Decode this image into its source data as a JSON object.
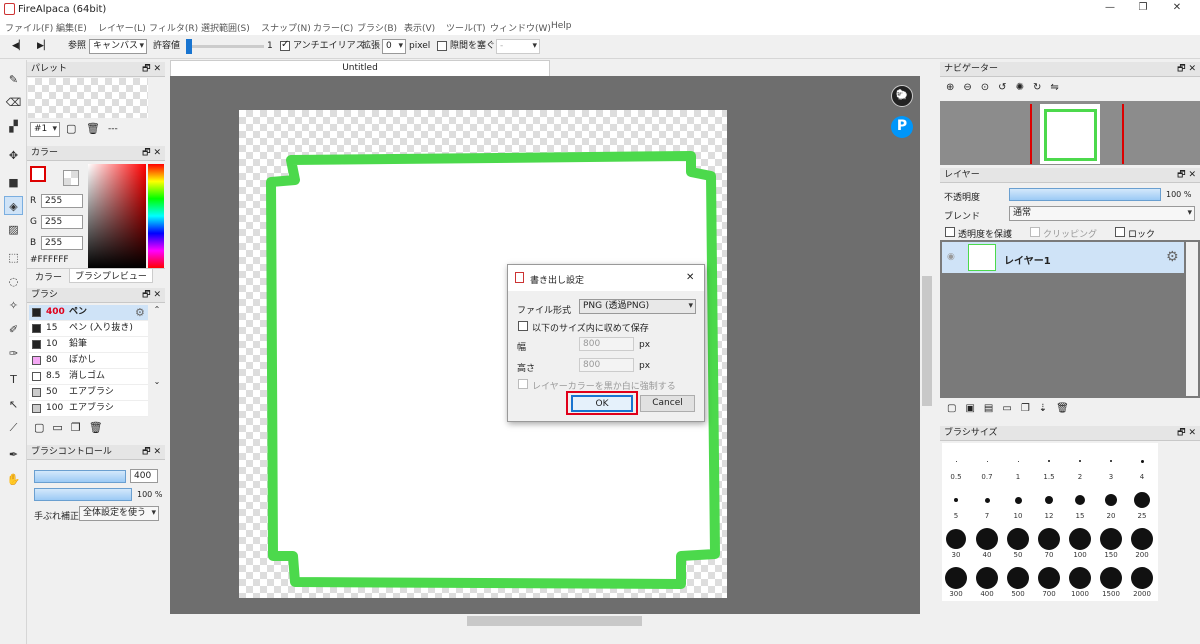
{
  "window": {
    "title": "FireAlpaca (64bit)",
    "min": "—",
    "max": "❐",
    "close": "✕"
  },
  "menu": [
    "ファイル(F)",
    "編集(E)",
    "レイヤー(L)",
    "フィルタ(R)",
    "選択範囲(S)",
    "スナップ(N)",
    "カラー(C)",
    "ブラシ(B)",
    "表示(V)",
    "ツール(T)",
    "ウィンドウ(W)",
    "Help"
  ],
  "toolbar": {
    "prev": "◀▏",
    "next": "▶▏",
    "ref_label": "参照",
    "ref_value": "キャンバス",
    "tolerance_label": "許容値",
    "tolerance_value": "1",
    "antialias_label": "アンチエイリアス",
    "expand_label": "拡張",
    "expand_value": "0",
    "expand_unit": "pixel",
    "gap_label": "隙間を塞ぐ",
    "gap_value": "-"
  },
  "palette": {
    "title": "パレット",
    "number": "#1",
    "dash": "---"
  },
  "color": {
    "title": "カラー",
    "r_label": "R",
    "r": "255",
    "g_label": "G",
    "g": "255",
    "b_label": "B",
    "b": "255",
    "hex": "#FFFFFF",
    "tab_color": "カラー",
    "tab_preview": "ブラシプレビュー"
  },
  "brush": {
    "title": "ブラシ",
    "items": [
      {
        "size": "400",
        "name": "ペン",
        "color": "#222222"
      },
      {
        "size": "15",
        "name": "ペン (入り抜き)",
        "color": "#222222"
      },
      {
        "size": "10",
        "name": "鉛筆",
        "color": "#222222"
      },
      {
        "size": "80",
        "name": "ぼかし",
        "color": "#f4a8f4"
      },
      {
        "size": "8.5",
        "name": "消しゴム",
        "color": "#ffffff"
      },
      {
        "size": "50",
        "name": "エアブラシ",
        "color": "#cccccc"
      },
      {
        "size": "100",
        "name": "エアブラシ",
        "color": "#cccccc"
      }
    ]
  },
  "brush_control": {
    "title": "ブラシコントロール",
    "size": "400",
    "opacity": "100 %",
    "stabilizer_label": "手ぶれ補正",
    "stabilizer_value": "全体設定を使う"
  },
  "canvas": {
    "tab": "Untitled",
    "stroke_color": "#4cd94c"
  },
  "dialog": {
    "title": "書き出し設定",
    "close": "✕",
    "format_label": "ファイル形式",
    "format_value": "PNG (透過PNG)",
    "fit_label": "以下のサイズ内に収めて保存",
    "width_label": "幅",
    "width_value": "800",
    "height_label": "高さ",
    "height_value": "800",
    "unit": "px",
    "force_label": "レイヤーカラーを黒か白に強制する",
    "ok": "OK",
    "cancel": "Cancel"
  },
  "navigator": {
    "title": "ナビゲーター"
  },
  "layer": {
    "title": "レイヤー",
    "opacity_label": "不透明度",
    "opacity_value": "100 %",
    "blend_label": "ブレンド",
    "blend_value": "通常",
    "protect_label": "透明度を保護",
    "clip_label": "クリッピング",
    "lock_label": "ロック",
    "layer_name": "レイヤー1"
  },
  "brush_size": {
    "title": "ブラシサイズ",
    "sizes": [
      "0.5",
      "0.7",
      "1",
      "1.5",
      "2",
      "3",
      "4",
      "5",
      "7",
      "10",
      "12",
      "15",
      "20",
      "25",
      "30",
      "40",
      "50",
      "70",
      "100",
      "150",
      "200",
      "300",
      "400",
      "500",
      "700",
      "1000",
      "1500",
      "2000"
    ]
  }
}
